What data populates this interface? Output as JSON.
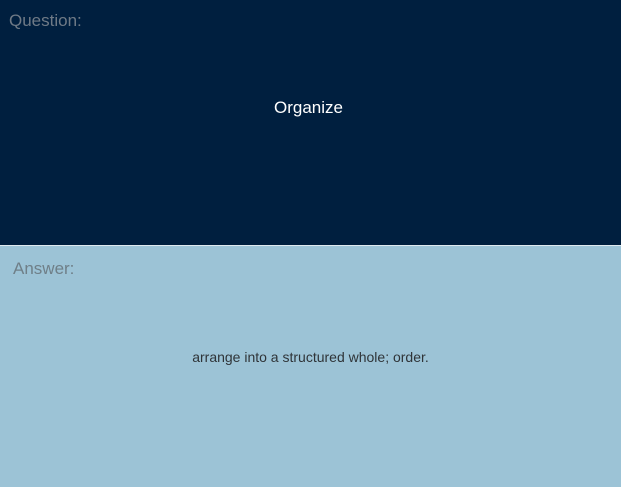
{
  "question": {
    "label": "Question:",
    "text": "Organize"
  },
  "answer": {
    "label": "Answer:",
    "text": "arrange into a structured whole; order."
  },
  "colors": {
    "question_bg": "#001f3f",
    "answer_bg": "#9cc3d6",
    "label_text": "#6f7a86",
    "question_text": "#ffffff",
    "answer_text": "#2f3438"
  }
}
